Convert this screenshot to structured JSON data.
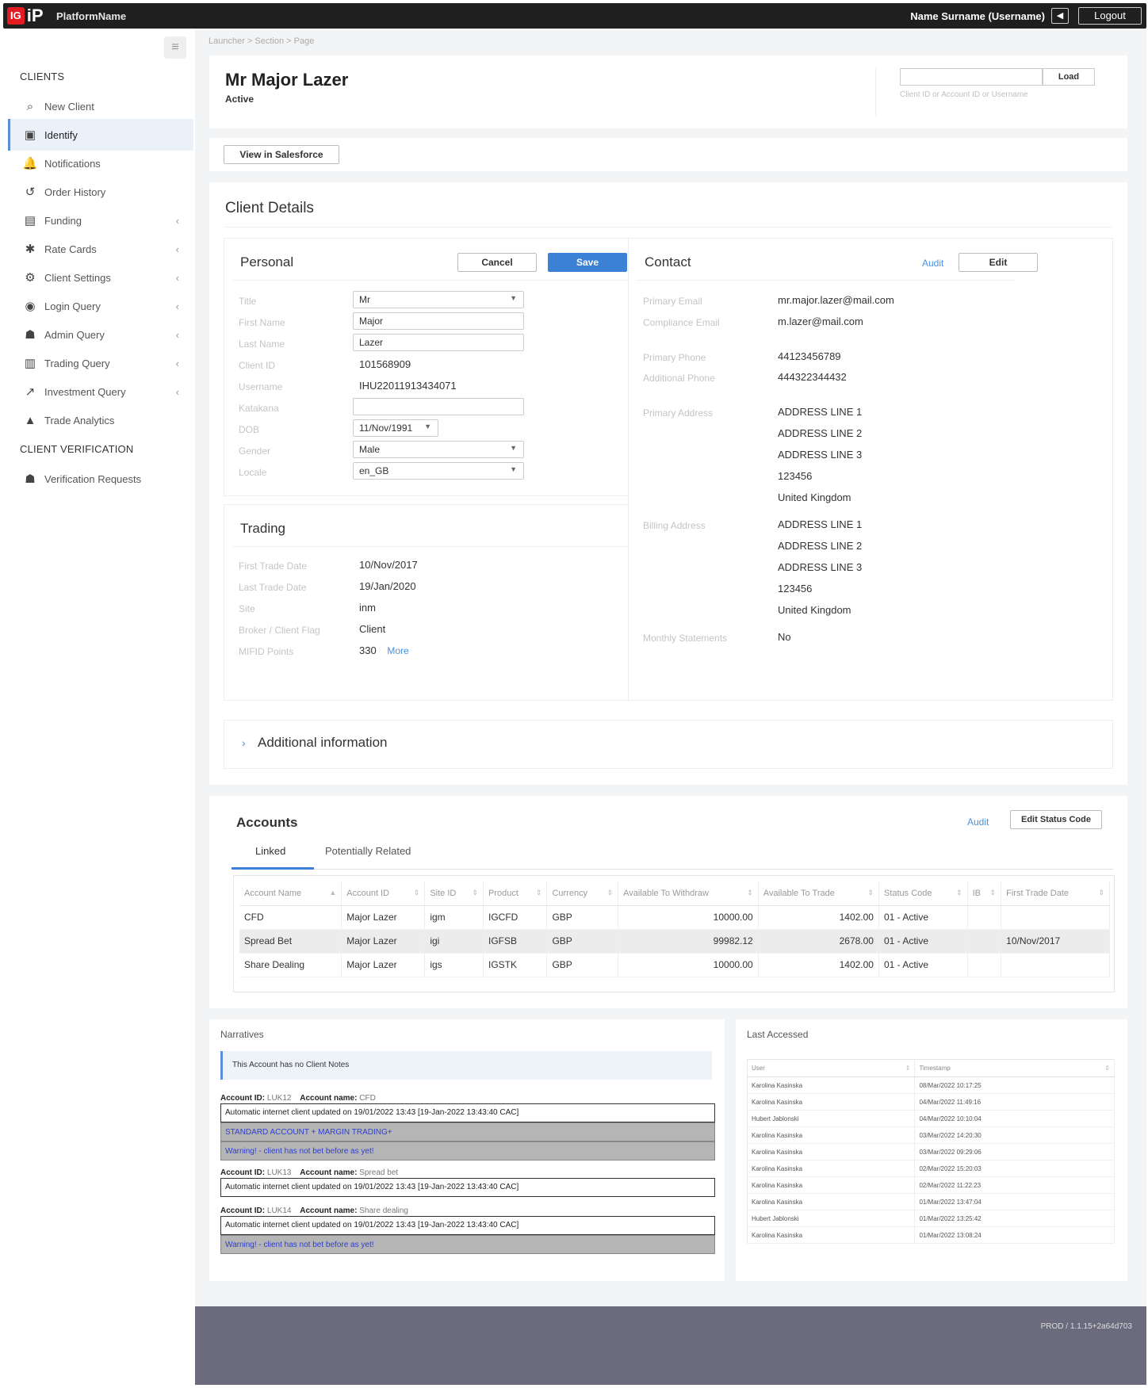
{
  "topbar": {
    "logo_ig": "IG",
    "logo_ip": "iP",
    "platform_name": "PlatformName",
    "user_name": "Name Surname (Username)",
    "sound_icon": "speaker-icon",
    "logout_label": "Logout"
  },
  "breadcrumb": "Launcher > Section > Page",
  "sidebar": {
    "section_clients": "CLIENTS",
    "items": [
      {
        "label": "New Client",
        "icon": "search-icon",
        "glyph": "⌕"
      },
      {
        "label": "Identify",
        "icon": "id-card-icon",
        "glyph": "▣"
      },
      {
        "label": "Notifications",
        "icon": "bell-icon",
        "glyph": "🔔"
      },
      {
        "label": "Order History",
        "icon": "history-icon",
        "glyph": "↺"
      },
      {
        "label": "Funding",
        "icon": "money-icon",
        "glyph": "▤"
      },
      {
        "label": "Rate Cards",
        "icon": "gear-icon",
        "glyph": "✱"
      },
      {
        "label": "Client Settings",
        "icon": "settings-icon",
        "glyph": "⚙"
      },
      {
        "label": "Login Query",
        "icon": "eye-icon",
        "glyph": "◉"
      },
      {
        "label": "Admin Query",
        "icon": "users-icon",
        "glyph": "☗"
      },
      {
        "label": "Trading Query",
        "icon": "bar-chart-icon",
        "glyph": "▥"
      },
      {
        "label": "Investment Query",
        "icon": "line-chart-icon",
        "glyph": "↗"
      },
      {
        "label": "Trade Analytics",
        "icon": "area-chart-icon",
        "glyph": "▲"
      }
    ],
    "section_verification": "CLIENT VERIFICATION",
    "verification_item": {
      "label": "Verification Requests",
      "icon": "users-icon",
      "glyph": "☗"
    }
  },
  "header": {
    "client_name": "Mr Major Lazer",
    "status": "Active",
    "load_placeholder": "",
    "load_label": "Load",
    "load_hint": "Client ID or Account ID or Username"
  },
  "salesforce_label": "View in Salesforce",
  "details": {
    "title": "Client Details",
    "personal": {
      "title": "Personal",
      "cancel": "Cancel",
      "save": "Save",
      "labels": {
        "title": "Title",
        "first_name": "First Name",
        "last_name": "Last Name",
        "client_id": "Client ID",
        "username": "Username",
        "katakana": "Katakana",
        "dob": "DOB",
        "gender": "Gender",
        "locale": "Locale"
      },
      "values": {
        "title": "Mr",
        "first_name": "Major",
        "last_name": "Lazer",
        "client_id": "101568909",
        "username": "IHU22011913434071",
        "katakana": "",
        "dob": "11/Nov/1991",
        "gender": "Male",
        "locale": "en_GB"
      }
    },
    "trading": {
      "title": "Trading",
      "labels": {
        "first_trade": "First Trade Date",
        "last_trade": "Last Trade Date",
        "site": "Site",
        "broker_flag": "Broker / Client Flag",
        "mifid": "MIFID Points"
      },
      "values": {
        "first_trade": "10/Nov/2017",
        "last_trade": "19/Jan/2020",
        "site": "inm",
        "broker_flag": "Client",
        "mifid": "330"
      },
      "more": "More"
    },
    "contact": {
      "title": "Contact",
      "audit": "Audit",
      "edit": "Edit",
      "labels": {
        "primary_email": "Primary Email",
        "compliance_email": "Compliance Email",
        "primary_phone": "Primary Phone",
        "additional_phone": "Additional Phone",
        "primary_address": "Primary Address",
        "billing_address": "Billing Address",
        "monthly_statements": "Monthly Statements"
      },
      "values": {
        "primary_email": "mr.major.lazer@mail.com",
        "compliance_email": "m.lazer@mail.com",
        "primary_phone": "44123456789",
        "additional_phone": "444322344432",
        "primary_address": [
          "ADDRESS LINE 1",
          "ADDRESS LINE 2",
          "ADDRESS LINE 3",
          "123456",
          "United Kingdom"
        ],
        "billing_address": [
          "ADDRESS LINE 1",
          "ADDRESS LINE 2",
          "ADDRESS LINE 3",
          "123456",
          "United Kingdom"
        ],
        "monthly_statements": "No"
      }
    },
    "additional_info": "Additional information"
  },
  "accounts": {
    "title": "Accounts",
    "audit": "Audit",
    "edit_status": "Edit Status Code",
    "tabs": [
      "Linked",
      "Potentially Related"
    ],
    "columns": [
      "Account Name",
      "Account ID",
      "Site ID",
      "Product",
      "Currency",
      "Available To Withdraw",
      "Available To Trade",
      "Status Code",
      "IB",
      "First Trade Date"
    ],
    "rows": [
      [
        "CFD",
        "Major Lazer",
        "igm",
        "IGCFD",
        "GBP",
        "10000.00",
        "1402.00",
        "01 - Active",
        "",
        ""
      ],
      [
        "Spread Bet",
        "Major Lazer",
        "igi",
        "IGFSB",
        "GBP",
        "99982.12",
        "2678.00",
        "01 - Active",
        "",
        "10/Nov/2017"
      ],
      [
        "Share Dealing",
        "Major Lazer",
        "igs",
        "IGSTK",
        "GBP",
        "10000.00",
        "1402.00",
        "01 - Active",
        "",
        ""
      ]
    ]
  },
  "narratives": {
    "title": "Narratives",
    "note": "This Account has no Client Notes",
    "blocks": [
      {
        "id_label": "Account ID:",
        "id": "LUK12",
        "name_label": "Account name:",
        "name": "CFD",
        "text": "Automatic internet client updated on 19/01/2022 13:43 [19-Jan-2022 13:43:40 CAC]",
        "extra": [
          "STANDARD ACCOUNT + MARGIN TRADING+",
          "Warning! - client has not bet before as yet!"
        ]
      },
      {
        "id_label": "Account ID:",
        "id": "LUK13",
        "name_label": "Account name:",
        "name": "Spread bet",
        "text": "Automatic internet client updated on 19/01/2022 13:43 [19-Jan-2022 13:43:40 CAC]",
        "extra": []
      },
      {
        "id_label": "Account ID:",
        "id": "LUK14",
        "name_label": "Account name:",
        "name": "Share dealing",
        "text": "Automatic internet client updated on 19/01/2022 13:43 [19-Jan-2022 13:43:40 CAC]",
        "extra": [
          "Warning! - client has not bet before as yet!"
        ]
      }
    ]
  },
  "last_accessed": {
    "title": "Last Accessed",
    "columns": [
      "User",
      "Timestamp"
    ],
    "rows": [
      [
        "Karolina Kasinska",
        "08/Mar/2022 10:17:25"
      ],
      [
        "Karolina Kasinska",
        "04/Mar/2022 11:49:16"
      ],
      [
        "Hubert Jablonski",
        "04/Mar/2022 10:10:04"
      ],
      [
        "Karolina Kasinska",
        "03/Mar/2022 14:20:30"
      ],
      [
        "Karolina Kasinska",
        "03/Mar/2022 09:29:06"
      ],
      [
        "Karolina Kasinska",
        "02/Mar/2022 15:20:03"
      ],
      [
        "Karolina Kasinska",
        "02/Mar/2022 11:22:23"
      ],
      [
        "Karolina Kasinska",
        "01/Mar/2022 13:47:04"
      ],
      [
        "Hubert Jablonski",
        "01/Mar/2022 13:25:42"
      ],
      [
        "Karolina Kasinska",
        "01/Mar/2022 13:08:24"
      ]
    ]
  },
  "footer": {
    "version": "PROD / 1.1.15+2a64d703"
  },
  "colors": {
    "accent": "#3b82d6",
    "topbar": "#1f1f1f",
    "footer": "#6b6b7d",
    "logo": "#e31b23"
  }
}
